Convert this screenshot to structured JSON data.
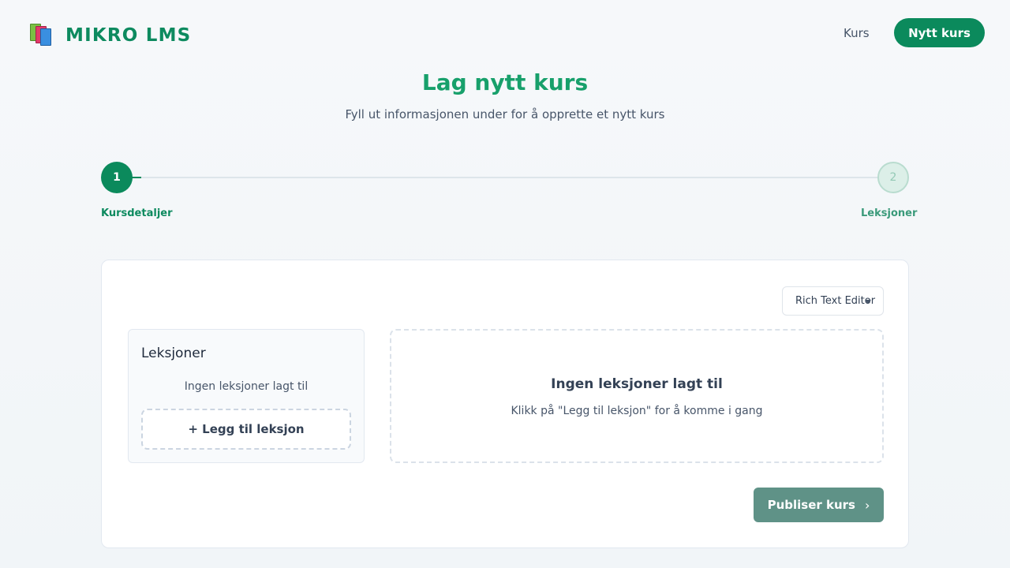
{
  "header": {
    "logo_text": "MIKRO LMS",
    "nav_link": "Kurs",
    "nav_button": "Nytt kurs"
  },
  "page": {
    "title": "Lag nytt kurs",
    "subtitle": "Fyll ut informasjonen under for å opprette et nytt kurs"
  },
  "stepper": {
    "steps": [
      {
        "number": "1",
        "label": "Kursdetaljer",
        "state": "active"
      },
      {
        "number": "2",
        "label": "Leksjoner",
        "state": "inactive"
      }
    ]
  },
  "card": {
    "editor_select": {
      "value": "Rich Text Editor"
    },
    "lessons_panel": {
      "title": "Leksjoner",
      "empty_text": "Ingen leksjoner lagt til",
      "add_button": "+ Legg til leksjon"
    },
    "empty_state": {
      "title": "Ingen leksjoner lagt til",
      "text": "Klikk på \"Legg til leksjon\" for å komme i gang"
    },
    "publish_button": "Publiser kurs",
    "publish_icon": "chevron-right-icon"
  },
  "colors": {
    "brand": "#0b8a5c",
    "title_green": "#17a06b",
    "publish_button": "#5f9287"
  }
}
